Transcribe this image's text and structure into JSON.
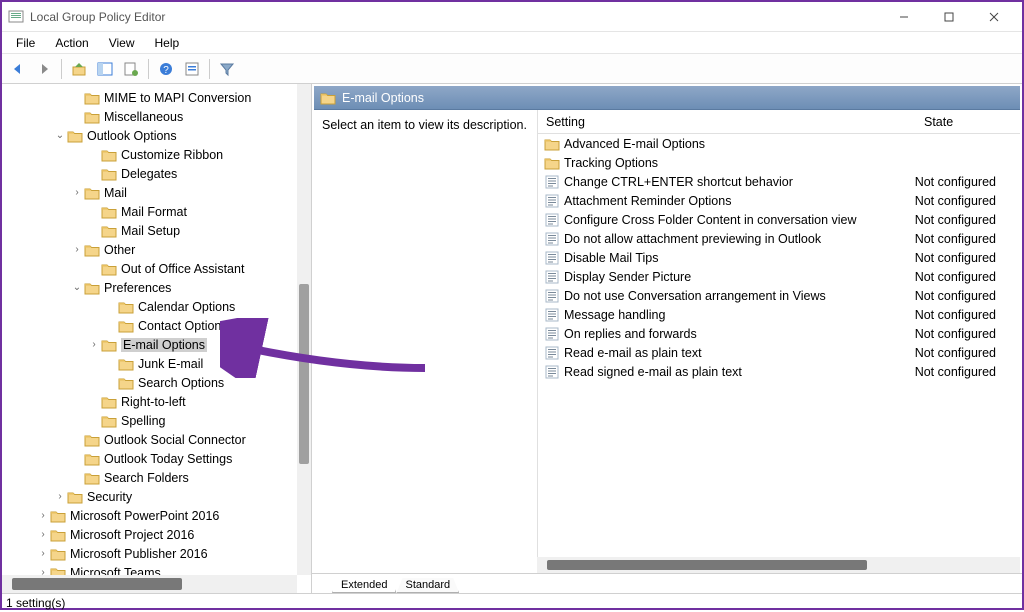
{
  "window": {
    "title": "Local Group Policy Editor"
  },
  "menu": {
    "items": [
      "File",
      "Action",
      "View",
      "Help"
    ]
  },
  "tree": [
    {
      "indent": 4,
      "twisty": "",
      "label": "MIME to MAPI Conversion"
    },
    {
      "indent": 4,
      "twisty": "",
      "label": "Miscellaneous"
    },
    {
      "indent": 3,
      "twisty": "v",
      "label": "Outlook Options"
    },
    {
      "indent": 5,
      "twisty": "",
      "label": "Customize Ribbon"
    },
    {
      "indent": 5,
      "twisty": "",
      "label": "Delegates"
    },
    {
      "indent": 4,
      "twisty": ">",
      "label": "Mail"
    },
    {
      "indent": 5,
      "twisty": "",
      "label": "Mail Format"
    },
    {
      "indent": 5,
      "twisty": "",
      "label": "Mail Setup"
    },
    {
      "indent": 4,
      "twisty": ">",
      "label": "Other"
    },
    {
      "indent": 5,
      "twisty": "",
      "label": "Out of Office Assistant"
    },
    {
      "indent": 4,
      "twisty": "v",
      "label": "Preferences"
    },
    {
      "indent": 6,
      "twisty": "",
      "label": "Calendar Options"
    },
    {
      "indent": 6,
      "twisty": "",
      "label": "Contact Options"
    },
    {
      "indent": 5,
      "twisty": ">",
      "label": "E-mail Options",
      "selected": true
    },
    {
      "indent": 6,
      "twisty": "",
      "label": "Junk E-mail"
    },
    {
      "indent": 6,
      "twisty": "",
      "label": "Search Options"
    },
    {
      "indent": 5,
      "twisty": "",
      "label": "Right-to-left"
    },
    {
      "indent": 5,
      "twisty": "",
      "label": "Spelling"
    },
    {
      "indent": 4,
      "twisty": "",
      "label": "Outlook Social Connector"
    },
    {
      "indent": 4,
      "twisty": "",
      "label": "Outlook Today Settings"
    },
    {
      "indent": 4,
      "twisty": "",
      "label": "Search Folders"
    },
    {
      "indent": 3,
      "twisty": ">",
      "label": "Security"
    },
    {
      "indent": 2,
      "twisty": ">",
      "label": "Microsoft PowerPoint 2016"
    },
    {
      "indent": 2,
      "twisty": ">",
      "label": "Microsoft Project 2016"
    },
    {
      "indent": 2,
      "twisty": ">",
      "label": "Microsoft Publisher 2016"
    },
    {
      "indent": 2,
      "twisty": ">",
      "label": "Microsoft Teams"
    }
  ],
  "details": {
    "header": "E-mail Options",
    "description": "Select an item to view its description.",
    "columns": {
      "setting": "Setting",
      "state": "State"
    },
    "rows": [
      {
        "type": "folder",
        "name": "Advanced E-mail Options",
        "state": ""
      },
      {
        "type": "folder",
        "name": "Tracking Options",
        "state": ""
      },
      {
        "type": "policy",
        "name": "Change CTRL+ENTER shortcut behavior",
        "state": "Not configured"
      },
      {
        "type": "policy",
        "name": "Attachment Reminder Options",
        "state": "Not configured"
      },
      {
        "type": "policy",
        "name": "Configure Cross Folder Content in conversation view",
        "state": "Not configured"
      },
      {
        "type": "policy",
        "name": "Do not allow attachment previewing in Outlook",
        "state": "Not configured"
      },
      {
        "type": "policy",
        "name": "Disable Mail Tips",
        "state": "Not configured"
      },
      {
        "type": "policy",
        "name": "Display Sender Picture",
        "state": "Not configured"
      },
      {
        "type": "policy",
        "name": "Do not use Conversation arrangement in Views",
        "state": "Not configured"
      },
      {
        "type": "policy",
        "name": "Message handling",
        "state": "Not configured"
      },
      {
        "type": "policy",
        "name": "On replies and forwards",
        "state": "Not configured"
      },
      {
        "type": "policy",
        "name": "Read e-mail as plain text",
        "state": "Not configured"
      },
      {
        "type": "policy",
        "name": "Read signed e-mail as plain text",
        "state": "Not configured"
      }
    ]
  },
  "tabs": {
    "extended": "Extended",
    "standard": "Standard"
  },
  "status": "1 setting(s)"
}
